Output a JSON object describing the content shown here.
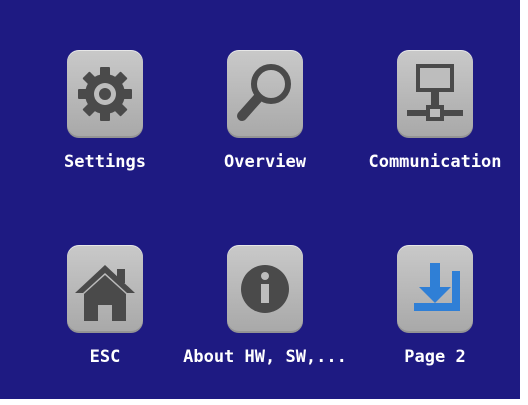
{
  "menu": {
    "tiles": [
      {
        "label": "Settings",
        "icon": "gear-icon"
      },
      {
        "label": "Overview",
        "icon": "magnifier-icon"
      },
      {
        "label": "Communication",
        "icon": "network-icon"
      },
      {
        "label": "ESC",
        "icon": "home-icon"
      },
      {
        "label": "About HW, SW,...",
        "icon": "info-icon"
      },
      {
        "label": "Page 2",
        "icon": "download-arrow-icon"
      }
    ]
  },
  "colors": {
    "background": "#1e1a82",
    "tile": "#bdbdbd",
    "icon_dark": "#4a4a4a",
    "accent_blue": "#2f7fd6",
    "label": "#ffffff"
  }
}
